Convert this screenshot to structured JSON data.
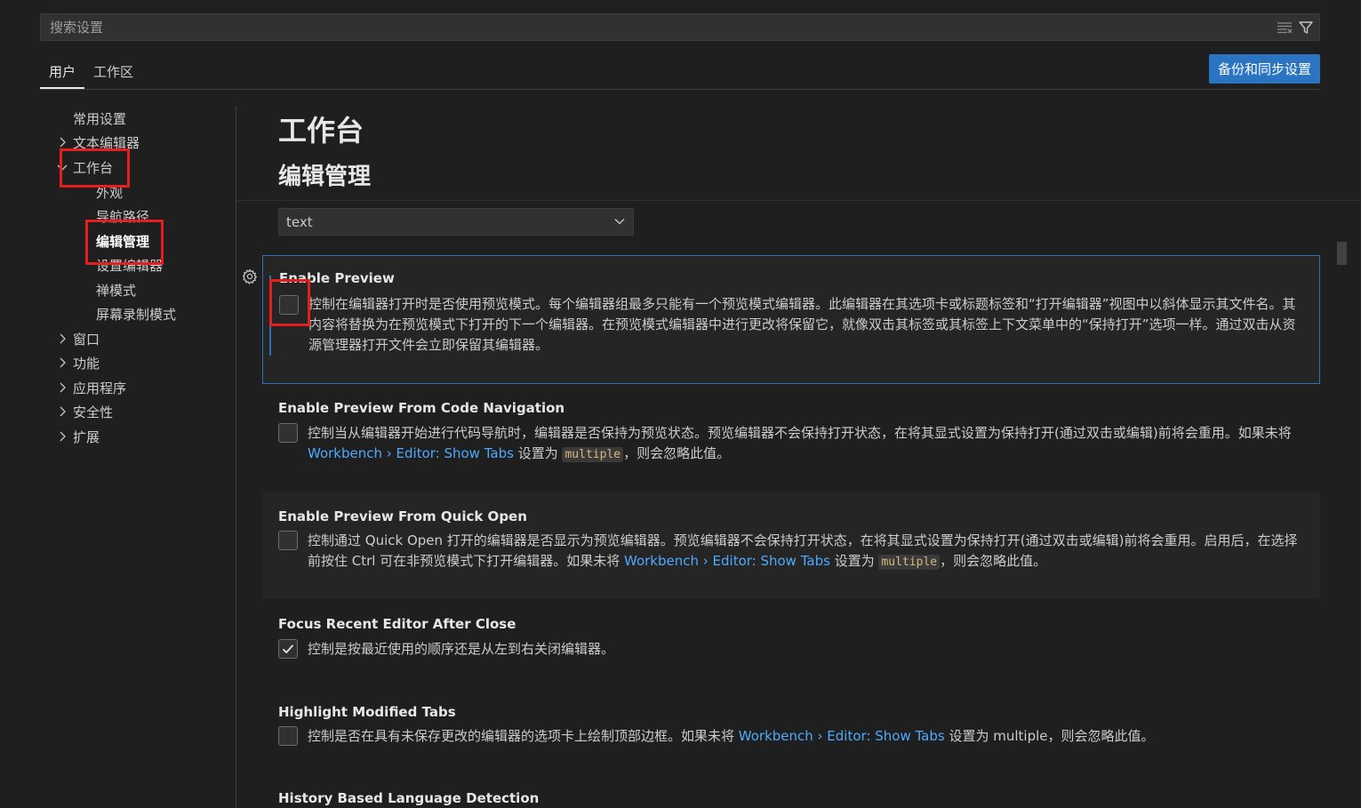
{
  "search": {
    "placeholder": "搜索设置"
  },
  "tabs": [
    {
      "label": "用户",
      "active": true
    },
    {
      "label": "工作区",
      "active": false
    }
  ],
  "sync_button": "备份和同步设置",
  "toc": {
    "items": [
      {
        "label": "常用设置"
      },
      {
        "label": "文本编辑器"
      },
      {
        "label": "工作台"
      },
      {
        "label": "外观"
      },
      {
        "label": "导航路径"
      },
      {
        "label": "编辑管理"
      },
      {
        "label": "设置编辑器"
      },
      {
        "label": "禅模式"
      },
      {
        "label": "屏幕录制模式"
      },
      {
        "label": "窗口"
      },
      {
        "label": "功能"
      },
      {
        "label": "应用程序"
      },
      {
        "label": "安全性"
      },
      {
        "label": "扩展"
      }
    ]
  },
  "main": {
    "title": "工作台",
    "subtitle": "编辑管理",
    "language_select": "text"
  },
  "settings": [
    {
      "title": "Enable Preview",
      "checked": false,
      "desc": "控制在编辑器打开时是否使用预览模式。每个编辑器组最多只能有一个预览模式编辑器。此编辑器在其选项卡或标题标签和“打开编辑器”视图中以斜体显示其文件名。其内容将替换为在预览模式下打开的下一个编辑器。在预览模式编辑器中进行更改将保留它，就像双击其标签或其标签上下文菜单中的“保持打开”选项一样。通过双击从资源管理器打开文件会立即保留其编辑器。"
    },
    {
      "title": "Enable Preview From Code Navigation",
      "checked": false,
      "desc_a": "控制当从编辑器开始进行代码导航时，编辑器是否保持为预览状态。预览编辑器不会保持打开状态，在将其显式设置为保持打开(通过双击或编辑)前将会重用。如果未将 ",
      "link": "Workbench › Editor: Show Tabs",
      "desc_b": " 设置为 ",
      "code": "multiple",
      "desc_c": "，则会忽略此值。"
    },
    {
      "title": "Enable Preview From Quick Open",
      "checked": false,
      "desc_a": "控制通过 Quick Open 打开的编辑器是否显示为预览编辑器。预览编辑器不会保持打开状态，在将其显式设置为保持打开(通过双击或编辑)前将会重用。启用后，在选择前按住 Ctrl 可在非预览模式下打开编辑器。如果未将 ",
      "link": "Workbench › Editor: Show Tabs",
      "desc_b": " 设置为 ",
      "code": "multiple",
      "desc_c": "，则会忽略此值。"
    },
    {
      "title": "Focus Recent Editor After Close",
      "checked": true,
      "desc": "控制是按最近使用的顺序还是从左到右关闭编辑器。"
    },
    {
      "title": "Highlight Modified Tabs",
      "checked": false,
      "desc_a": "控制是否在具有未保存更改的编辑器的选项卡上绘制顶部边框。如果未将 ",
      "link": "Workbench › Editor: Show Tabs",
      "desc_b": " 设置为 multiple，则会忽略此值。"
    },
    {
      "title": "History Based Language Detection"
    }
  ],
  "colors": {
    "accent": "#2b74c1",
    "focus_border": "#2f6fb6",
    "highlight_box": "#e51f1f",
    "link": "#4daafc"
  }
}
